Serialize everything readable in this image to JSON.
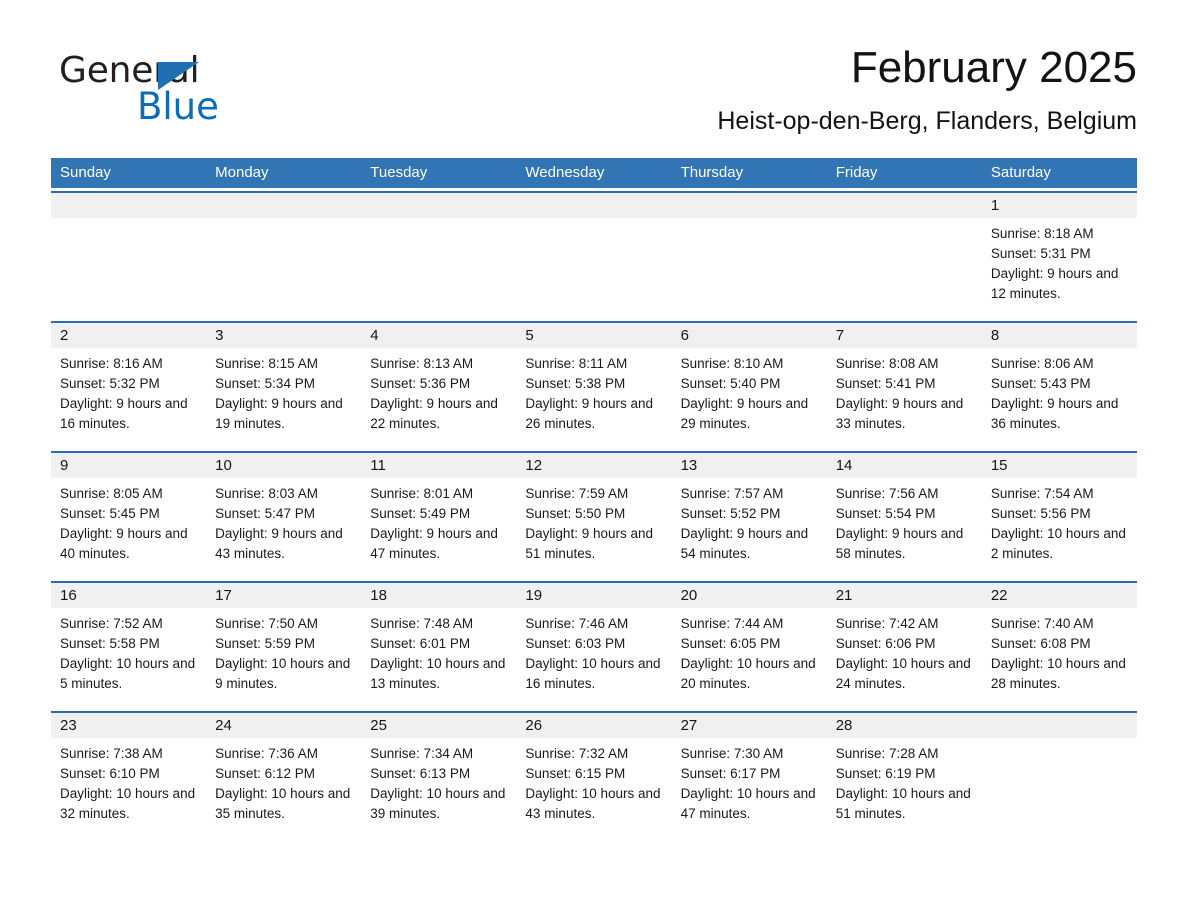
{
  "brand": {
    "name_part1": "General",
    "name_part2": "Blue",
    "triangle_color": "#1f6fb2",
    "blue_text_color": "#0b6cb7"
  },
  "header": {
    "month_title": "February 2025",
    "location": "Heist-op-den-Berg, Flanders, Belgium"
  },
  "colors": {
    "header_blue": "#3175b5",
    "row_border_blue": "#2a6cad",
    "day_band_gray": "#f0f0f0"
  },
  "weekdays": [
    "Sunday",
    "Monday",
    "Tuesday",
    "Wednesday",
    "Thursday",
    "Friday",
    "Saturday"
  ],
  "weeks": [
    [
      {
        "day": "",
        "empty": true
      },
      {
        "day": "",
        "empty": true
      },
      {
        "day": "",
        "empty": true
      },
      {
        "day": "",
        "empty": true
      },
      {
        "day": "",
        "empty": true
      },
      {
        "day": "",
        "empty": true
      },
      {
        "day": "1",
        "sunrise": "Sunrise: 8:18 AM",
        "sunset": "Sunset: 5:31 PM",
        "daylight": "Daylight: 9 hours and 12 minutes."
      }
    ],
    [
      {
        "day": "2",
        "sunrise": "Sunrise: 8:16 AM",
        "sunset": "Sunset: 5:32 PM",
        "daylight": "Daylight: 9 hours and 16 minutes."
      },
      {
        "day": "3",
        "sunrise": "Sunrise: 8:15 AM",
        "sunset": "Sunset: 5:34 PM",
        "daylight": "Daylight: 9 hours and 19 minutes."
      },
      {
        "day": "4",
        "sunrise": "Sunrise: 8:13 AM",
        "sunset": "Sunset: 5:36 PM",
        "daylight": "Daylight: 9 hours and 22 minutes."
      },
      {
        "day": "5",
        "sunrise": "Sunrise: 8:11 AM",
        "sunset": "Sunset: 5:38 PM",
        "daylight": "Daylight: 9 hours and 26 minutes."
      },
      {
        "day": "6",
        "sunrise": "Sunrise: 8:10 AM",
        "sunset": "Sunset: 5:40 PM",
        "daylight": "Daylight: 9 hours and 29 minutes."
      },
      {
        "day": "7",
        "sunrise": "Sunrise: 8:08 AM",
        "sunset": "Sunset: 5:41 PM",
        "daylight": "Daylight: 9 hours and 33 minutes."
      },
      {
        "day": "8",
        "sunrise": "Sunrise: 8:06 AM",
        "sunset": "Sunset: 5:43 PM",
        "daylight": "Daylight: 9 hours and 36 minutes."
      }
    ],
    [
      {
        "day": "9",
        "sunrise": "Sunrise: 8:05 AM",
        "sunset": "Sunset: 5:45 PM",
        "daylight": "Daylight: 9 hours and 40 minutes."
      },
      {
        "day": "10",
        "sunrise": "Sunrise: 8:03 AM",
        "sunset": "Sunset: 5:47 PM",
        "daylight": "Daylight: 9 hours and 43 minutes."
      },
      {
        "day": "11",
        "sunrise": "Sunrise: 8:01 AM",
        "sunset": "Sunset: 5:49 PM",
        "daylight": "Daylight: 9 hours and 47 minutes."
      },
      {
        "day": "12",
        "sunrise": "Sunrise: 7:59 AM",
        "sunset": "Sunset: 5:50 PM",
        "daylight": "Daylight: 9 hours and 51 minutes."
      },
      {
        "day": "13",
        "sunrise": "Sunrise: 7:57 AM",
        "sunset": "Sunset: 5:52 PM",
        "daylight": "Daylight: 9 hours and 54 minutes."
      },
      {
        "day": "14",
        "sunrise": "Sunrise: 7:56 AM",
        "sunset": "Sunset: 5:54 PM",
        "daylight": "Daylight: 9 hours and 58 minutes."
      },
      {
        "day": "15",
        "sunrise": "Sunrise: 7:54 AM",
        "sunset": "Sunset: 5:56 PM",
        "daylight": "Daylight: 10 hours and 2 minutes."
      }
    ],
    [
      {
        "day": "16",
        "sunrise": "Sunrise: 7:52 AM",
        "sunset": "Sunset: 5:58 PM",
        "daylight": "Daylight: 10 hours and 5 minutes."
      },
      {
        "day": "17",
        "sunrise": "Sunrise: 7:50 AM",
        "sunset": "Sunset: 5:59 PM",
        "daylight": "Daylight: 10 hours and 9 minutes."
      },
      {
        "day": "18",
        "sunrise": "Sunrise: 7:48 AM",
        "sunset": "Sunset: 6:01 PM",
        "daylight": "Daylight: 10 hours and 13 minutes."
      },
      {
        "day": "19",
        "sunrise": "Sunrise: 7:46 AM",
        "sunset": "Sunset: 6:03 PM",
        "daylight": "Daylight: 10 hours and 16 minutes."
      },
      {
        "day": "20",
        "sunrise": "Sunrise: 7:44 AM",
        "sunset": "Sunset: 6:05 PM",
        "daylight": "Daylight: 10 hours and 20 minutes."
      },
      {
        "day": "21",
        "sunrise": "Sunrise: 7:42 AM",
        "sunset": "Sunset: 6:06 PM",
        "daylight": "Daylight: 10 hours and 24 minutes."
      },
      {
        "day": "22",
        "sunrise": "Sunrise: 7:40 AM",
        "sunset": "Sunset: 6:08 PM",
        "daylight": "Daylight: 10 hours and 28 minutes."
      }
    ],
    [
      {
        "day": "23",
        "sunrise": "Sunrise: 7:38 AM",
        "sunset": "Sunset: 6:10 PM",
        "daylight": "Daylight: 10 hours and 32 minutes."
      },
      {
        "day": "24",
        "sunrise": "Sunrise: 7:36 AM",
        "sunset": "Sunset: 6:12 PM",
        "daylight": "Daylight: 10 hours and 35 minutes."
      },
      {
        "day": "25",
        "sunrise": "Sunrise: 7:34 AM",
        "sunset": "Sunset: 6:13 PM",
        "daylight": "Daylight: 10 hours and 39 minutes."
      },
      {
        "day": "26",
        "sunrise": "Sunrise: 7:32 AM",
        "sunset": "Sunset: 6:15 PM",
        "daylight": "Daylight: 10 hours and 43 minutes."
      },
      {
        "day": "27",
        "sunrise": "Sunrise: 7:30 AM",
        "sunset": "Sunset: 6:17 PM",
        "daylight": "Daylight: 10 hours and 47 minutes."
      },
      {
        "day": "28",
        "sunrise": "Sunrise: 7:28 AM",
        "sunset": "Sunset: 6:19 PM",
        "daylight": "Daylight: 10 hours and 51 minutes."
      },
      {
        "day": "",
        "empty": true
      }
    ]
  ]
}
